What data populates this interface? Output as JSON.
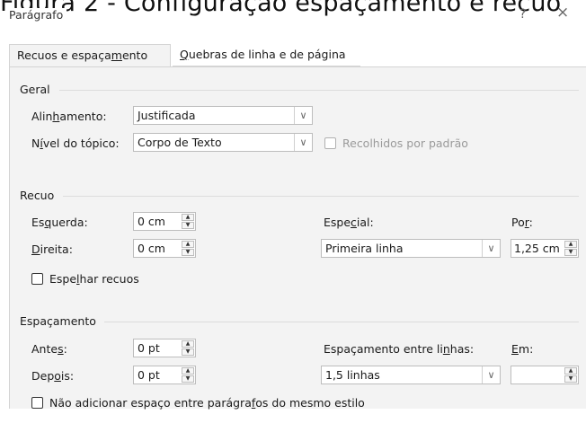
{
  "caption": "Figura 2 - Configuração espaçamento e recuo",
  "dialog": {
    "title": "Parágrafo",
    "help_icon": "?",
    "close_icon": "×"
  },
  "tabs": [
    {
      "label_pre": "Recuos e espaça",
      "label_key": "m",
      "label_post": "ento"
    },
    {
      "label_pre": "",
      "label_key": "Q",
      "label_post": "uebras de linha e de página"
    }
  ],
  "geral": {
    "title": "Geral",
    "alinhamento": {
      "label_pre": "Alin",
      "label_key": "h",
      "label_post": "amento:",
      "value": "Justificada"
    },
    "nivel": {
      "label_pre": "N",
      "label_key": "í",
      "label_post": "vel do tópico:",
      "value": "Corpo de Texto"
    },
    "recolhidos": {
      "label": "Recolhidos por padrão",
      "checked": false,
      "enabled": false
    }
  },
  "recuo": {
    "title": "Recuo",
    "esquerda": {
      "label_pre": "Es",
      "label_key": "q",
      "label_post": "uerda:",
      "value": "0 cm"
    },
    "direita": {
      "label_pre": "",
      "label_key": "D",
      "label_post": "ireita:",
      "value": "0 cm"
    },
    "especial": {
      "label_pre": "Espe",
      "label_key": "c",
      "label_post": "ial:",
      "value": "Primeira linha"
    },
    "por": {
      "label_pre": "Po",
      "label_key": "r",
      "label_post": ":",
      "value": "1,25 cm"
    },
    "espelhar": {
      "label_pre": "Espe",
      "label_key": "l",
      "label_post": "har recuos",
      "checked": false
    }
  },
  "espacamento": {
    "title": "Espaçamento",
    "antes": {
      "label_pre": "Ante",
      "label_key": "s",
      "label_post": ":",
      "value": "0 pt"
    },
    "depois": {
      "label_pre": "Dep",
      "label_key": "o",
      "label_post": "is:",
      "value": "0 pt"
    },
    "entre_linhas": {
      "label_pre": "Espaçamento entre li",
      "label_key": "n",
      "label_post": "has:",
      "value": "1,5 linhas"
    },
    "em": {
      "label_pre": "",
      "label_key": "E",
      "label_post": "m:",
      "value": ""
    },
    "nao_adicionar": {
      "label_pre": "Não adicionar espaço entre parágra",
      "label_key": "f",
      "label_post": "os do mesmo estilo",
      "checked": false
    }
  }
}
